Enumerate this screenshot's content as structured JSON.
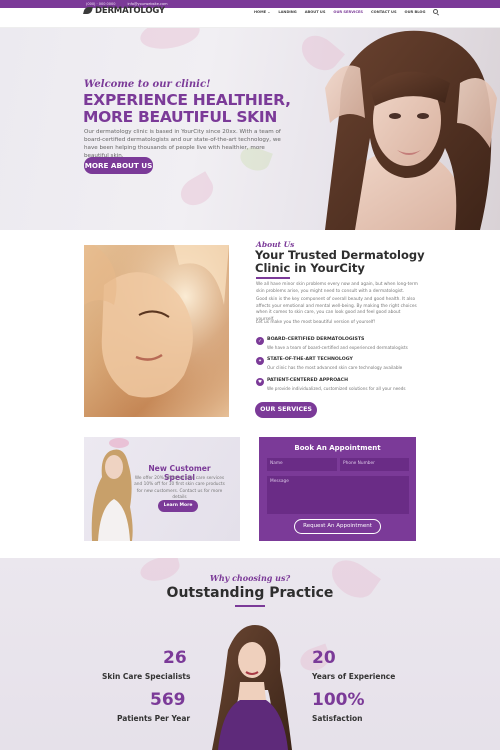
{
  "topbar": {
    "phone": "(000) · 000 0000",
    "email": "info@yourwebsite.com"
  },
  "header": {
    "logo_text": "DERMATOLOGY",
    "nav": [
      {
        "label": "HOME ⌄",
        "active": false
      },
      {
        "label": "LANDING",
        "active": false
      },
      {
        "label": "ABOUT US",
        "active": false
      },
      {
        "label": "OUR SERVICES",
        "active": true
      },
      {
        "label": "CONTACT US",
        "active": false
      },
      {
        "label": "OUR BLOG",
        "active": false
      }
    ]
  },
  "hero": {
    "script": "Welcome to our clinic!",
    "title": "EXPERIENCE HEALTHIER, MORE BEAUTIFUL SKIN",
    "text": "Our dermatology clinic is based in YourCity since 20xx. With a team of board-certified dermatologists and our state-of-the-art technology, we have been helping thousands of people live with healthier, more beautiful skin.",
    "button": "MORE ABOUT US"
  },
  "about": {
    "script": "About Us",
    "title": "Your Trusted Dermatology Clinic in YourCity",
    "p1": "We all have minor skin problems every now and again, but when long-term skin problems arise, you might need to consult with a dermatologist.",
    "p2": "Good skin is the key component of overall beauty and good health. It also affects your emotional and mental well-being. By making the right choices when it comes to skin care, you can look good and feel good about yourself.",
    "p3": "Let us make you the most beautiful version of yourself!",
    "features": [
      {
        "title": "BOARD-CERTIFIED DERMATOLOGISTS",
        "desc": "We have a team of board-certified and experienced dermatologists"
      },
      {
        "title": "STATE-OF-THE-ART TECHNOLOGY",
        "desc": "Our clinic has the most advanced skin care technology available"
      },
      {
        "title": "PATIENT-CENTERED APPROACH",
        "desc": "We provide individualized, customized solutions for all your needs"
      }
    ],
    "button": "OUR SERVICES"
  },
  "special": {
    "title": "New Customer Special",
    "text": "We offer 20% off for all skin care services and 10% off for 10 first skin care products for new customers. Contact us for more details",
    "button": "Learn More"
  },
  "appointment": {
    "title": "Book An Appointment",
    "name_placeholder": "Name",
    "phone_placeholder": "Phone Number",
    "message_placeholder": "Message",
    "button": "Request An Appointment"
  },
  "outstanding": {
    "script": "Why choosing us?",
    "title": "Outstanding Practice",
    "stats": [
      {
        "value": "26",
        "label": "Skin Care Specialists"
      },
      {
        "value": "569",
        "label": "Patients Per Year"
      },
      {
        "value": "20",
        "label": "Years of Experience"
      },
      {
        "value": "100%",
        "label": "Satisfaction"
      }
    ]
  },
  "colors": {
    "accent": "#7b3a98",
    "dark_text": "#2e2e2e"
  }
}
